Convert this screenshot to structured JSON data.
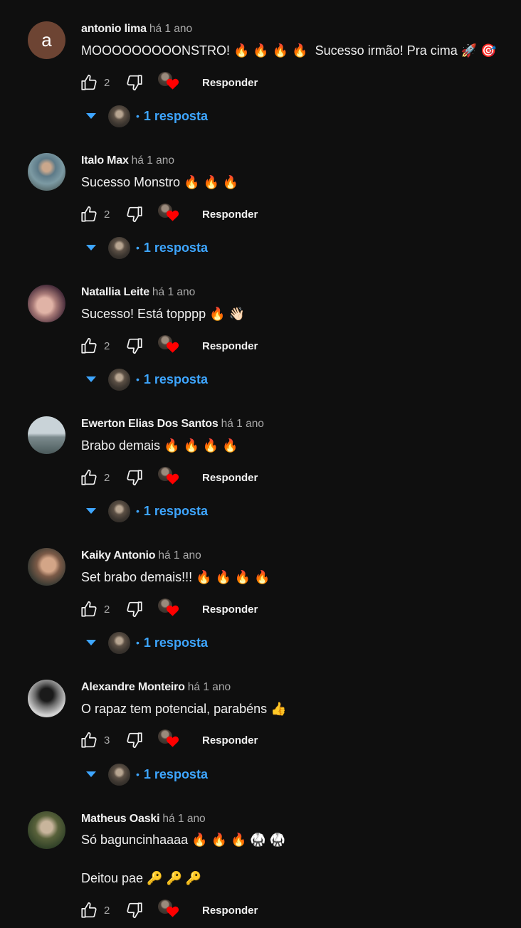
{
  "comments": [
    {
      "author": "antonio lima",
      "time": "há 1 ano",
      "avatar_letter": "a",
      "text": "MOOOOOOOOONSTRO! 🔥 🔥 🔥 🔥  Sucesso irmão! Pra cima 🚀 🎯",
      "likes": "2",
      "reply_label": "Responder",
      "replies_label": "1 resposta"
    },
    {
      "author": "Italo Max",
      "time": "há 1 ano",
      "text": "Sucesso Monstro 🔥 🔥 🔥",
      "likes": "2",
      "reply_label": "Responder",
      "replies_label": "1 resposta"
    },
    {
      "author": "Natallia Leite",
      "time": "há 1 ano",
      "text": "Sucesso! Está topppp 🔥 👋🏻",
      "likes": "2",
      "reply_label": "Responder",
      "replies_label": "1 resposta"
    },
    {
      "author": "Ewerton Elias Dos Santos",
      "time": "há 1 ano",
      "text": "Brabo demais 🔥 🔥 🔥 🔥",
      "likes": "2",
      "reply_label": "Responder",
      "replies_label": "1 resposta"
    },
    {
      "author": "Kaiky Antonio",
      "time": "há 1 ano",
      "text": "Set brabo demais!!! 🔥 🔥 🔥 🔥",
      "likes": "2",
      "reply_label": "Responder",
      "replies_label": "1 resposta"
    },
    {
      "author": "Alexandre Monteiro",
      "time": "há 1 ano",
      "text": "O rapaz tem potencial, parabéns 👍",
      "likes": "3",
      "reply_label": "Responder",
      "replies_label": "1 resposta"
    },
    {
      "author": "Matheus Oaski",
      "time": "há 1 ano",
      "text": "Só baguncinhaaaa 🔥 🔥 🔥 🥋 🥋\n\nDeitou pae 🔑 🔑 🔑",
      "likes": "2",
      "reply_label": "Responder"
    }
  ],
  "colors": {
    "background": "#0f0f0f",
    "link": "#3ea6ff",
    "heart": "#ff0000",
    "avatar_letter_bg": "#6d4433"
  }
}
